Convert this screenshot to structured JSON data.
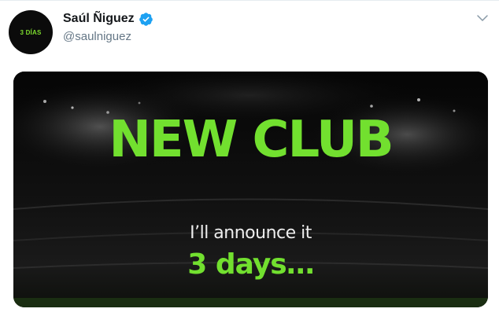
{
  "tweet": {
    "display_name": "Saúl Ñiguez",
    "handle": "@saulniguez",
    "avatar_text": "3 DÍAS",
    "verified_icon": "verified-badge-icon",
    "menu_icon": "chevron-down-icon"
  },
  "media": {
    "headline": "NEW CLUB",
    "subline": "I’ll announce it",
    "highlight": "3 days…"
  },
  "colors": {
    "accent_green": "#72e02f",
    "verified_blue": "#1da1f2",
    "name_text": "#14171a",
    "handle_text": "#657786"
  }
}
